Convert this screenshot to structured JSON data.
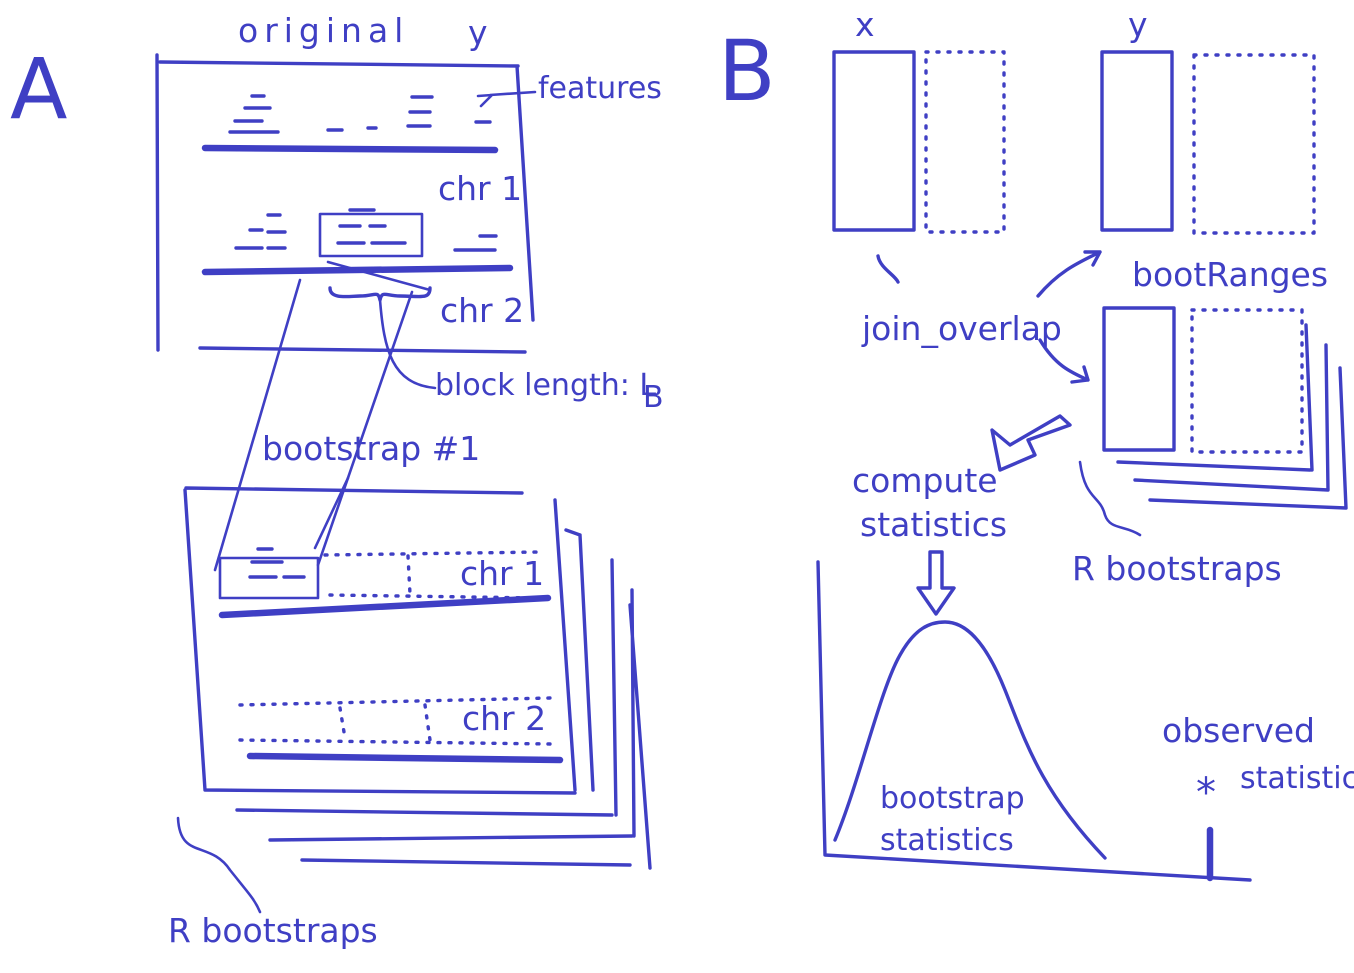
{
  "panels": {
    "A": {
      "letter": "A",
      "original_label": "original",
      "y_label": "y",
      "features_label": "features",
      "chr1_label": "chr 1",
      "chr2_label": "chr 2",
      "block_length_label": "block length: L",
      "block_length_subscript": "B",
      "bootstrap_label": "bootstrap #1",
      "boot_chr1_label": "chr 1",
      "boot_chr2_label": "chr 2",
      "r_bootstraps_label": "R bootstraps"
    },
    "B": {
      "letter": "B",
      "x_label": "x",
      "y_label": "y",
      "join_overlap_label": "join_overlap",
      "bootranges_label": "bootRanges",
      "compute_label": "compute",
      "statistics_label": "statistics",
      "r_bootstraps_label": "R bootstraps",
      "bootstrap_label": "bootstrap",
      "bootstrap_statistics_label": "statistics",
      "observed_label": "observed",
      "observed_statistic_label": "statistic",
      "star_symbol": "*"
    }
  },
  "colors": {
    "ink": "#3f3fc4",
    "background": "#ffffff"
  }
}
